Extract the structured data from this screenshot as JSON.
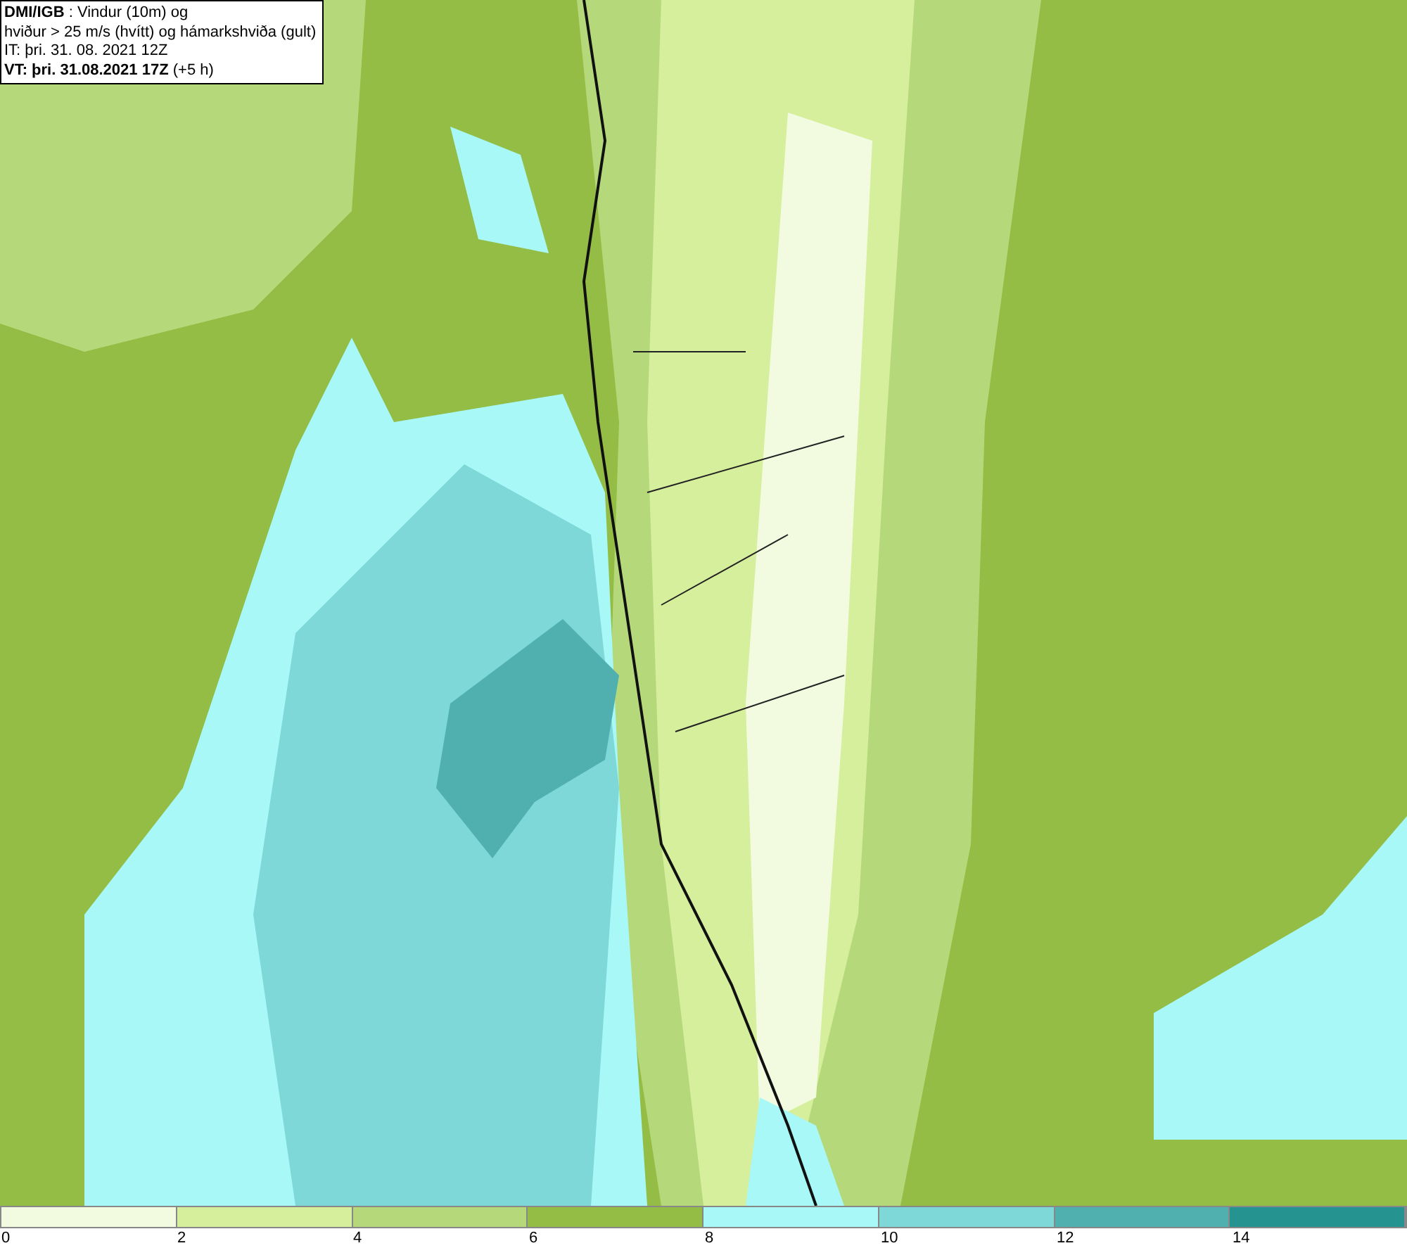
{
  "header": {
    "lines": [
      "**DMI/IGB** : Vindur (10m) og",
      "hviður > 25 m/s (hvítt) og hámarkshviða (gult)",
      "IT: þri. 31. 08. 2021 12Z",
      "**VT: þri. 31.08.2021 17Z** (+5 h)"
    ]
  },
  "legend": {
    "segments": [
      {
        "color": "#f2fbe0"
      },
      {
        "color": "#d6ef9c"
      },
      {
        "color": "#b5d97a"
      },
      {
        "color": "#93bd44"
      },
      {
        "color": "#a8f8f8"
      },
      {
        "color": "#7ed8d8"
      },
      {
        "color": "#50b0b0"
      },
      {
        "color": "#259490"
      }
    ],
    "ticks": [
      "0",
      "2",
      "4",
      "6",
      "8",
      "10",
      "12",
      "14"
    ]
  }
}
